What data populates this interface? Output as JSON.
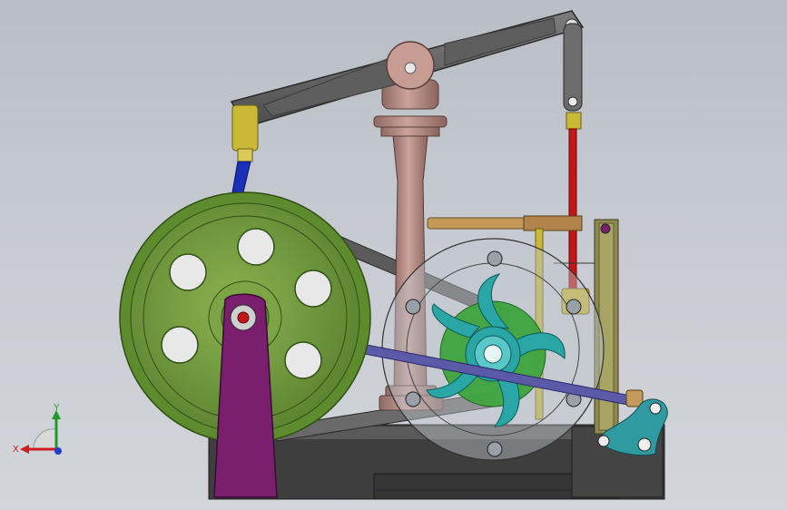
{
  "viewport": {
    "background_top": "#b9bec6",
    "background_bottom": "#d2d5da"
  },
  "triad": {
    "x_label": "X",
    "y_label": "Y",
    "x_color": "#cc1f1f",
    "y_color": "#1f9a2a",
    "z_color": "#1f3fcc"
  },
  "colors": {
    "beam": "#6b6b6b",
    "column": "#b88a80",
    "flywheel": "#6f9a3a",
    "crank_arm": "#7a1f6e",
    "impeller": "#2aa6a6",
    "hub": "#3fa53f",
    "push_rod": "#c01818",
    "left_rod": "#1c2fb8",
    "yellow_parts": "#c9b936",
    "base": "#4a4a4a",
    "bracket": "#2f9aa0"
  }
}
